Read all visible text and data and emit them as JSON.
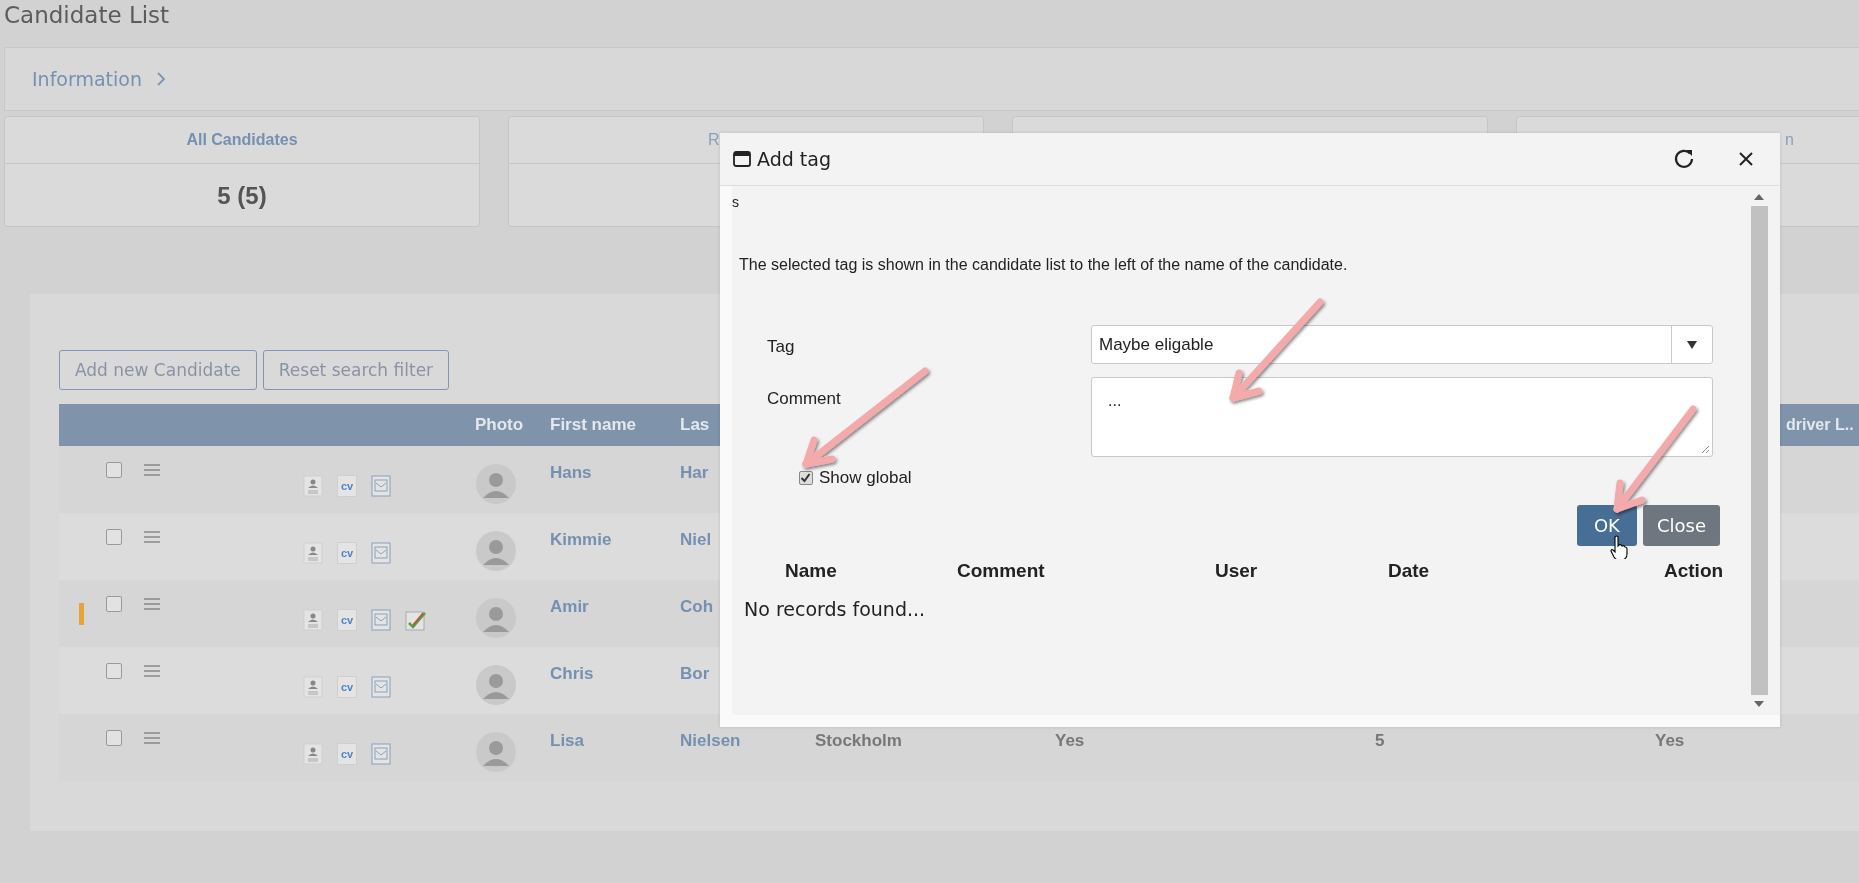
{
  "page": {
    "title": "Candidate List"
  },
  "breadcrumb": {
    "label": "Information"
  },
  "summary_cards": [
    {
      "kind": "summary",
      "title": "All Candidates",
      "value": "5 (5)"
    },
    {
      "kind": "summary",
      "title": "R"
    },
    {
      "kind": "summary"
    },
    {
      "kind": "summary",
      "title": "n"
    }
  ],
  "toolbar": {
    "buttons": [
      "Add new Candidate",
      "Reset search filter"
    ]
  },
  "table": {
    "columns": [
      {
        "label": "Photo"
      },
      {
        "label": "First name"
      },
      {
        "label": "Las"
      },
      {
        "label": "driver L.."
      }
    ],
    "rows": [
      {
        "tagged": false,
        "checked": false,
        "cv_label": "cv",
        "edit_note": false,
        "first_name": "Hans",
        "last_name": "Har"
      },
      {
        "tagged": false,
        "checked": false,
        "cv_label": "cv",
        "edit_note": false,
        "first_name": "Kimmie",
        "last_name": "Niel"
      },
      {
        "tagged": true,
        "checked": false,
        "cv_label": "cv",
        "edit_note": true,
        "first_name": "Amir",
        "last_name": "Coh"
      },
      {
        "tagged": false,
        "checked": false,
        "cv_label": "cv",
        "edit_note": false,
        "first_name": "Chris",
        "last_name": "Bor"
      },
      {
        "tagged": false,
        "checked": false,
        "cv_label": "cv",
        "edit_note": false,
        "first_name": "Lisa",
        "last_name": "Nielsen",
        "cells": [
          "Stockholm",
          "Yes",
          "5",
          "Yes"
        ]
      }
    ]
  },
  "dialog": {
    "title": "Add tag",
    "stray_text": "s",
    "description": "The selected tag is shown in the candidate list to the left of the name of the candidate.",
    "fields": [
      {
        "label": "Tag",
        "kind": "select",
        "value": "Maybe eligable"
      },
      {
        "label": "Comment",
        "kind": "textarea",
        "value": "..."
      }
    ],
    "show_global": {
      "label": "Show global",
      "checked": true
    },
    "buttons": [
      {
        "label": "OK",
        "kind": "primary"
      },
      {
        "label": "Close",
        "kind": "secondary"
      }
    ],
    "table": {
      "columns": [
        "Name",
        "Comment",
        "User",
        "Date",
        "Action"
      ],
      "empty_text": "No records found..."
    }
  }
}
